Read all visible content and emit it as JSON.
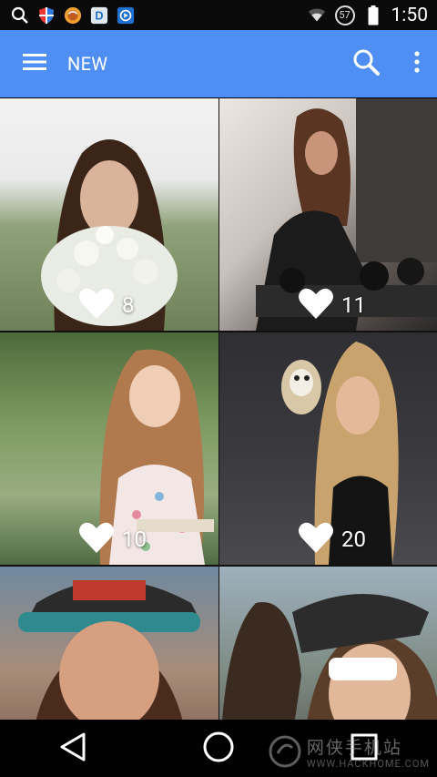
{
  "status_bar": {
    "time": "1:50",
    "notification_count": "57"
  },
  "app_bar": {
    "title": "NEW"
  },
  "tiles": [
    {
      "likes": "8"
    },
    {
      "likes": "11"
    },
    {
      "likes": "10"
    },
    {
      "likes": "20"
    },
    {
      "likes": ""
    },
    {
      "likes": ""
    }
  ],
  "watermark": {
    "cn": "网侠手机站",
    "en": "WWW.HACKHOME.COM"
  },
  "colors": {
    "app_bar": "#4F8FF5",
    "status_bar": "#0a0a0a",
    "nav_bar": "#000000"
  }
}
